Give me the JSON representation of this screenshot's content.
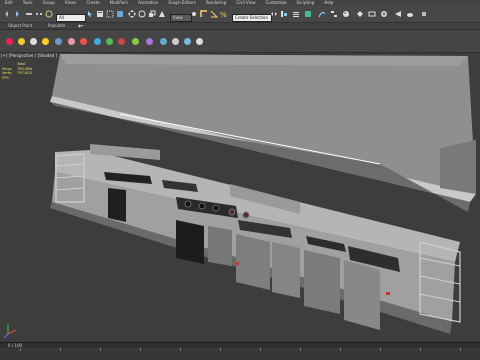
{
  "menu": [
    "Edit",
    "Tools",
    "Group",
    "Views",
    "Create",
    "Modifiers",
    "Animation",
    "Graph Editors",
    "Rendering",
    "Civil View",
    "Customize",
    "Scripting",
    "Help"
  ],
  "toolbar": {
    "selection_filter": "All",
    "view_ref": "View",
    "named_set": "Create Selection Se"
  },
  "ribbon": {
    "tabs": [
      "Object Paint",
      "Populate"
    ]
  },
  "viewport": {
    "label": "[+] [Perspective ] [Shaded ]",
    "stats": {
      "header": "Total",
      "polys_label": "Polys:",
      "polys": "785,986",
      "verts_label": "Verts:",
      "verts": "797,620",
      "fps_label": "FPS:"
    }
  },
  "timeline": {
    "frame": "0 / 100"
  },
  "colors": {
    "bg": "#3d3d3d",
    "hood": "#8a8a8a",
    "steel": "#a9a9a9"
  }
}
